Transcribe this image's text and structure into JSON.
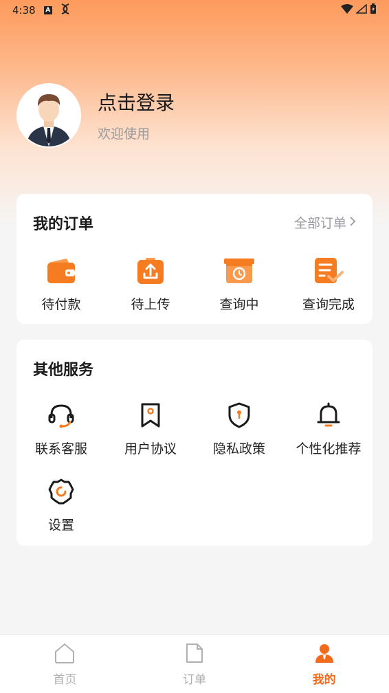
{
  "status_bar": {
    "time": "4:38",
    "indicator_1": "A",
    "indicator_2": ""
  },
  "profile": {
    "title": "点击登录",
    "subtitle": "欢迎使用"
  },
  "orders": {
    "title": "我的订单",
    "all_label": "全部订单",
    "items": [
      {
        "label": "待付款",
        "icon": "wallet-icon"
      },
      {
        "label": "待上传",
        "icon": "upload-icon"
      },
      {
        "label": "查询中",
        "icon": "clock-box-icon"
      },
      {
        "label": "查询完成",
        "icon": "document-check-icon"
      }
    ]
  },
  "services": {
    "title": "其他服务",
    "items": [
      {
        "label": "联系客服",
        "icon": "headset-icon"
      },
      {
        "label": "用户协议",
        "icon": "bookmark-icon"
      },
      {
        "label": "隐私政策",
        "icon": "shield-icon"
      },
      {
        "label": "个性化推荐",
        "icon": "bell-icon"
      },
      {
        "label": "设置",
        "icon": "gear-icon"
      }
    ]
  },
  "tabbar": {
    "tabs": [
      {
        "label": "首页",
        "icon": "home-icon"
      },
      {
        "label": "订单",
        "icon": "file-icon"
      },
      {
        "label": "我的",
        "icon": "person-icon",
        "active": true
      }
    ]
  },
  "colors": {
    "accent": "#f26b1d",
    "icon_orange": "#f57c20",
    "hero_top": "#fd9a5c"
  }
}
